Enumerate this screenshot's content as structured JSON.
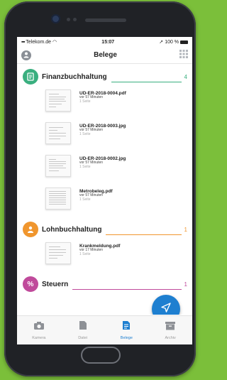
{
  "status_bar": {
    "carrier": "Telekom.de",
    "time": "15:07",
    "battery": "100 %"
  },
  "nav": {
    "title": "Belege"
  },
  "sections": [
    {
      "title": "Finanzbuchhaltung",
      "count": "4",
      "color": "#3aaf7f",
      "documents": [
        {
          "name": "UD-ER-2018-0004.pdf",
          "meta": "vor 57 Minuten",
          "pages": "1 Seite"
        },
        {
          "name": "UD-ER-2018-0003.jpg",
          "meta": "vor 57 Minuten",
          "pages": "1 Seite"
        },
        {
          "name": "UD-ER-2018-0002.jpg",
          "meta": "vor 57 Minuten",
          "pages": "1 Seite"
        },
        {
          "name": "Metrobeleg.pdf",
          "meta": "vor 57 Minuten",
          "pages": "1 Seite"
        }
      ]
    },
    {
      "title": "Lohnbuchhaltung",
      "count": "1",
      "color": "#f0962e",
      "documents": [
        {
          "name": "Krankmeldung.pdf",
          "meta": "vor 17 Minuten",
          "pages": "1 Seite"
        }
      ]
    },
    {
      "title": "Steuern",
      "count": "1",
      "color": "#c04a9b"
    }
  ],
  "tabs": [
    {
      "label": "Kamera",
      "icon": "camera-icon"
    },
    {
      "label": "Datei",
      "icon": "file-icon"
    },
    {
      "label": "Belege",
      "icon": "receipt-icon",
      "active": true
    },
    {
      "label": "Archiv",
      "icon": "archive-icon"
    }
  ],
  "colors": {
    "accent": "#1e7fd0",
    "background": "#7bbf3a"
  }
}
